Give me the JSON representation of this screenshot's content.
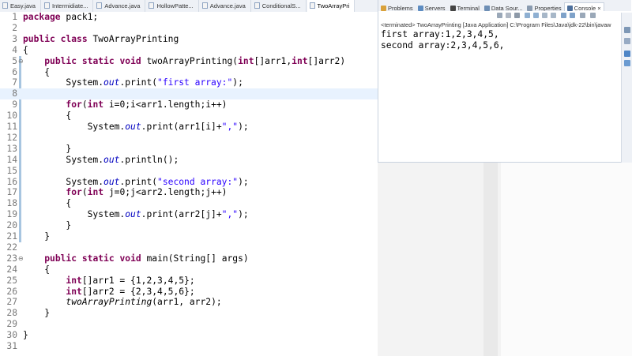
{
  "editor_tabs": [
    {
      "label": "Easy.java"
    },
    {
      "label": "Intermidiate..."
    },
    {
      "label": "Advance.java"
    },
    {
      "label": "HollowPatte..."
    },
    {
      "label": "Advance.java"
    },
    {
      "label": "ConditionalS..."
    },
    {
      "label": "TwoArrayPri",
      "active": true
    }
  ],
  "view_tabs": [
    {
      "label": "Problems",
      "icon": "problems-icon"
    },
    {
      "label": "Servers",
      "icon": "servers-icon"
    },
    {
      "label": "Terminal",
      "icon": "terminal-icon"
    },
    {
      "label": "Data Sour...",
      "icon": "data-source-icon"
    },
    {
      "label": "Properties",
      "icon": "properties-icon"
    },
    {
      "label": "Console",
      "icon": "console-icon",
      "active": true,
      "close": "×"
    }
  ],
  "console": {
    "status": "<terminated> TwoArrayPrinting [Java Application] C:\\Program Files\\Java\\jdk-22\\bin\\javaw",
    "output": [
      "first array:1,2,3,4,5,",
      "second array:2,3,4,5,6,"
    ]
  },
  "code": [
    {
      "n": "1",
      "text": "package pack1;"
    },
    {
      "n": "2",
      "text": ""
    },
    {
      "n": "3",
      "text": "public class TwoArrayPrinting"
    },
    {
      "n": "4",
      "text": "{"
    },
    {
      "n": "5",
      "marker": "⊖",
      "text": "    public static void twoArrayPrinting(int[]arr1,int[]arr2)"
    },
    {
      "n": "6",
      "text": "    {"
    },
    {
      "n": "7",
      "text": "        System.out.print(\"first array:\");"
    },
    {
      "n": "8",
      "text": ""
    },
    {
      "n": "9",
      "text": "        for(int i=0;i<arr1.length;i++)"
    },
    {
      "n": "10",
      "text": "        {"
    },
    {
      "n": "11",
      "text": "            System.out.print(arr1[i]+\",\");"
    },
    {
      "n": "12",
      "text": ""
    },
    {
      "n": "13",
      "text": "        }"
    },
    {
      "n": "14",
      "text": "        System.out.println();"
    },
    {
      "n": "15",
      "text": ""
    },
    {
      "n": "16",
      "text": "        System.out.print(\"second array:\");"
    },
    {
      "n": "17",
      "text": "        for(int j=0;j<arr2.length;j++)"
    },
    {
      "n": "18",
      "text": "        {"
    },
    {
      "n": "19",
      "text": "            System.out.print(arr2[j]+\",\");"
    },
    {
      "n": "20",
      "text": "        }"
    },
    {
      "n": "21",
      "text": "    }"
    },
    {
      "n": "22",
      "text": ""
    },
    {
      "n": "23",
      "marker": "⊖",
      "text": "    public static void main(String[] args)"
    },
    {
      "n": "24",
      "text": "    {"
    },
    {
      "n": "25",
      "text": "        int[]arr1 = {1,2,3,4,5};"
    },
    {
      "n": "26",
      "text": "        int[]arr2 = {2,3,4,5,6};"
    },
    {
      "n": "27",
      "text": "        twoArrayPrinting(arr1, arr2);"
    },
    {
      "n": "28",
      "text": "    }"
    },
    {
      "n": "29",
      "text": ""
    },
    {
      "n": "30",
      "text": "}"
    },
    {
      "n": "31",
      "text": ""
    }
  ],
  "current_line": "8",
  "colors": {
    "keyword": "#7f0055",
    "string": "#2a00ff",
    "field": "#0000c0",
    "highlight": "#e8f2fe"
  }
}
